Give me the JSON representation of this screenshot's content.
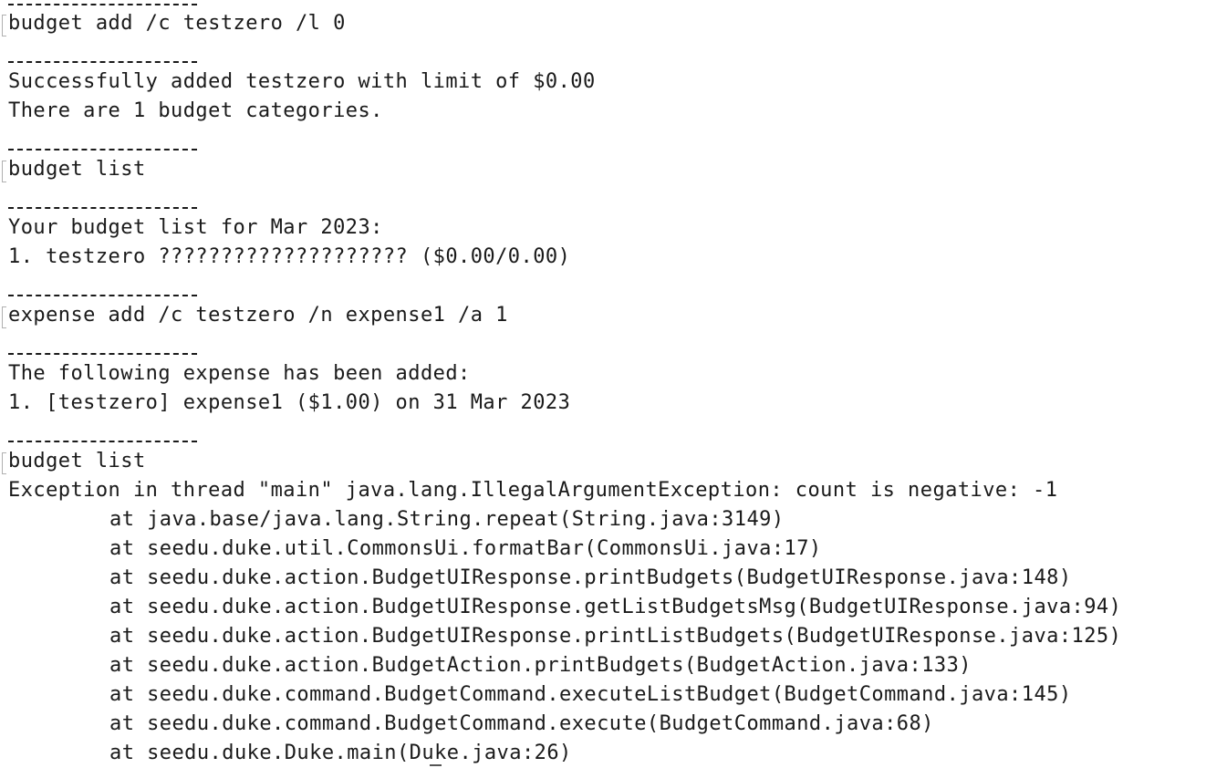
{
  "console": {
    "sessions": [
      {
        "command": "budget add /c testzero /l 0",
        "output": [
          "Successfully added testzero with limit of $0.00",
          "There are 1 budget categories."
        ]
      },
      {
        "command": "budget list",
        "output": [
          "Your budget list for Mar 2023:",
          "1. testzero ???????????????????? ($0.00/0.00)"
        ]
      },
      {
        "command": "expense add /c testzero /n expense1 /a 1",
        "output": [
          "The following expense has been added:",
          "1. [testzero] expense1 ($1.00) on 31 Mar 2023"
        ]
      },
      {
        "command": "budget list",
        "output": []
      }
    ],
    "exception": {
      "header": "Exception in thread \"main\" java.lang.IllegalArgumentException: count is negative: -1",
      "stack": [
        "at java.base/java.lang.String.repeat(String.java:3149)",
        "at seedu.duke.util.CommonsUi.formatBar(CommonsUi.java:17)",
        "at seedu.duke.action.BudgetUIResponse.printBudgets(BudgetUIResponse.java:148)",
        "at seedu.duke.action.BudgetUIResponse.getListBudgetsMsg(BudgetUIResponse.java:94)",
        "at seedu.duke.action.BudgetUIResponse.printListBudgets(BudgetUIResponse.java:125)",
        "at seedu.duke.action.BudgetAction.printBudgets(BudgetAction.java:133)",
        "at seedu.duke.command.BudgetCommand.executeListBudget(BudgetCommand.java:145)",
        "at seedu.duke.command.BudgetCommand.execute(BudgetCommand.java:68)",
        "at seedu.duke.Duke.main(Duke.java:26)"
      ]
    }
  }
}
